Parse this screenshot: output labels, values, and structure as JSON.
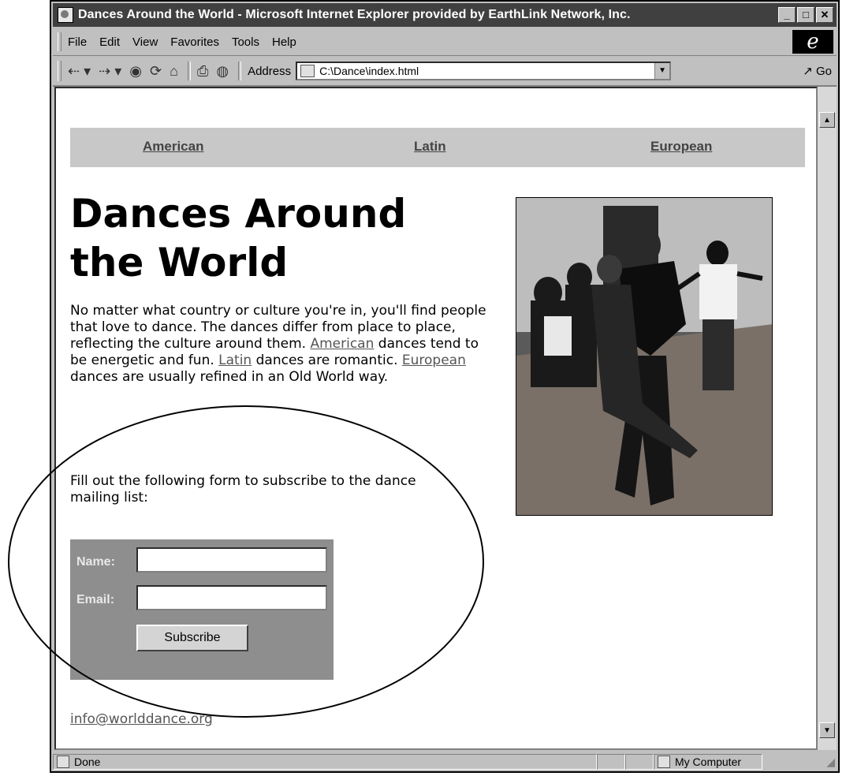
{
  "window": {
    "title": "Dances Around the World - Microsoft Internet Explorer provided by EarthLink Network, Inc."
  },
  "menu": [
    "File",
    "Edit",
    "View",
    "Favorites",
    "Tools",
    "Help"
  ],
  "toolbar": {
    "address_label": "Address",
    "address_value": "C:\\Dance\\index.html",
    "go_label": "Go"
  },
  "nav": {
    "american": "American",
    "latin": "Latin",
    "european": "European"
  },
  "page": {
    "heading": "Dances Around the World",
    "intro_1": "No matter what country or culture you're in, you'll find people that love to dance. The dances differ from place to place, reflecting the culture around them. ",
    "intro_link_american": "American",
    "intro_2": " dances tend to be energetic and fun. ",
    "intro_link_latin": "Latin",
    "intro_3": " dances are romantic. ",
    "intro_link_european": "European",
    "intro_4": " dances are usually refined in an Old World way.",
    "form_intro": "Fill out the following form to subscribe to the dance mailing list:",
    "email_link": "info@worlddance.org"
  },
  "form": {
    "name_label": "Name:",
    "name_value": "",
    "email_label": "Email:",
    "email_value": "",
    "submit_label": "Subscribe"
  },
  "status": {
    "text": "Done",
    "zone": "My Computer"
  }
}
